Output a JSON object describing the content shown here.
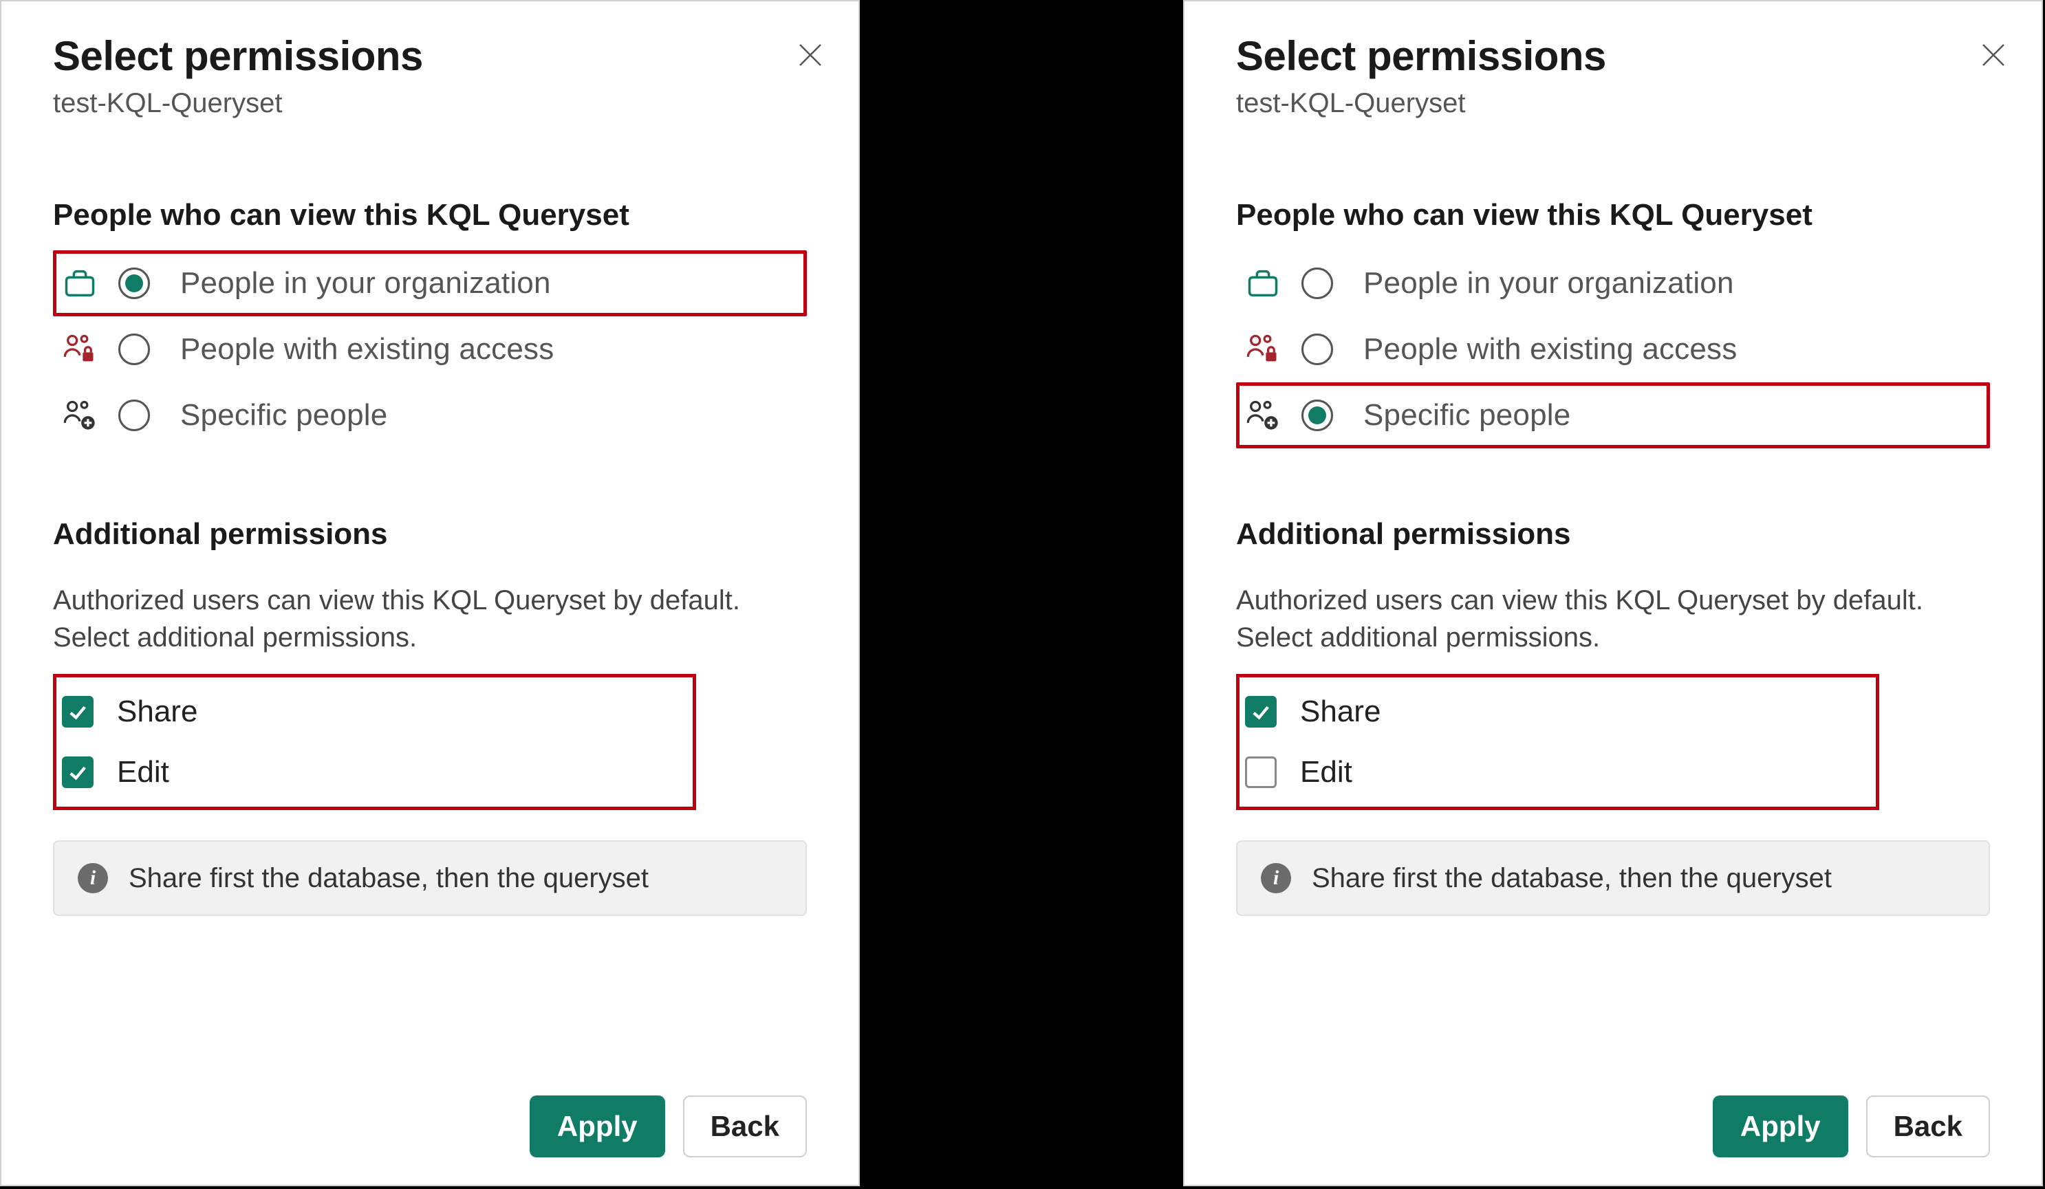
{
  "panels": [
    {
      "title": "Select permissions",
      "subtitle": "test-KQL-Queryset",
      "view_section_heading": "People who can view this KQL Queryset",
      "options": [
        {
          "label": "People in your organization",
          "selected": true,
          "highlighted": true
        },
        {
          "label": "People with existing access",
          "selected": false,
          "highlighted": false
        },
        {
          "label": "Specific people",
          "selected": false,
          "highlighted": false
        }
      ],
      "additional_heading": "Additional permissions",
      "additional_desc": "Authorized users can view this KQL Queryset by default. Select additional permissions.",
      "checks": [
        {
          "label": "Share",
          "checked": true
        },
        {
          "label": "Edit",
          "checked": true
        }
      ],
      "checks_highlighted": true,
      "info_text": "Share first the database, then the queryset",
      "apply_label": "Apply",
      "back_label": "Back"
    },
    {
      "title": "Select permissions",
      "subtitle": "test-KQL-Queryset",
      "view_section_heading": "People who can view this KQL Queryset",
      "options": [
        {
          "label": "People in your organization",
          "selected": false,
          "highlighted": false
        },
        {
          "label": "People with existing access",
          "selected": false,
          "highlighted": false
        },
        {
          "label": "Specific people",
          "selected": true,
          "highlighted": true
        }
      ],
      "additional_heading": "Additional permissions",
      "additional_desc": "Authorized users can view this KQL Queryset by default. Select additional permissions.",
      "checks": [
        {
          "label": "Share",
          "checked": true
        },
        {
          "label": "Edit",
          "checked": false
        }
      ],
      "checks_highlighted": true,
      "info_text": "Share first the database, then the queryset",
      "apply_label": "Apply",
      "back_label": "Back"
    }
  ]
}
